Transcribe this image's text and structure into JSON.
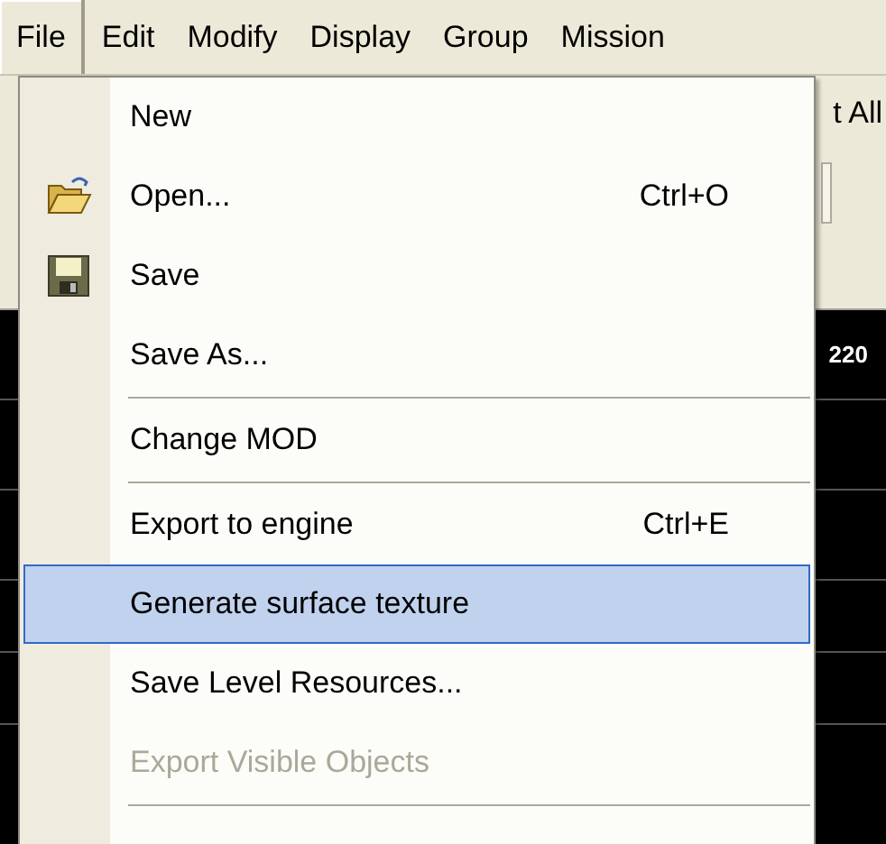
{
  "menu_bar": [
    {
      "label": "File",
      "selected": true
    },
    {
      "label": "Edit",
      "selected": false
    },
    {
      "label": "Modify",
      "selected": false
    },
    {
      "label": "Display",
      "selected": false
    },
    {
      "label": "Group",
      "selected": false
    },
    {
      "label": "Mission",
      "selected": false
    }
  ],
  "background": {
    "toolbar_text": "t All",
    "ruler_value": "220"
  },
  "file_menu": [
    {
      "kind": "item",
      "label": "New",
      "selected": false,
      "disabled": false
    },
    {
      "kind": "item",
      "label": "Open...",
      "shortcut": "Ctrl+O",
      "selected": false,
      "disabled": false
    },
    {
      "kind": "item",
      "label": "Save",
      "selected": false,
      "disabled": false
    },
    {
      "kind": "item",
      "label": "Save As...",
      "selected": false,
      "disabled": false
    },
    {
      "kind": "separator"
    },
    {
      "kind": "item",
      "label": "Change MOD",
      "selected": false,
      "disabled": false
    },
    {
      "kind": "separator"
    },
    {
      "kind": "item",
      "label": "Export to engine",
      "shortcut": "Ctrl+E",
      "selected": false,
      "disabled": false
    },
    {
      "kind": "item",
      "label": "Generate surface texture",
      "selected": true,
      "disabled": false
    },
    {
      "kind": "item",
      "label": "Save Level Resources...",
      "selected": false,
      "disabled": false
    },
    {
      "kind": "item",
      "label": "Export Visible Objects",
      "selected": false,
      "disabled": true
    },
    {
      "kind": "separator"
    }
  ]
}
